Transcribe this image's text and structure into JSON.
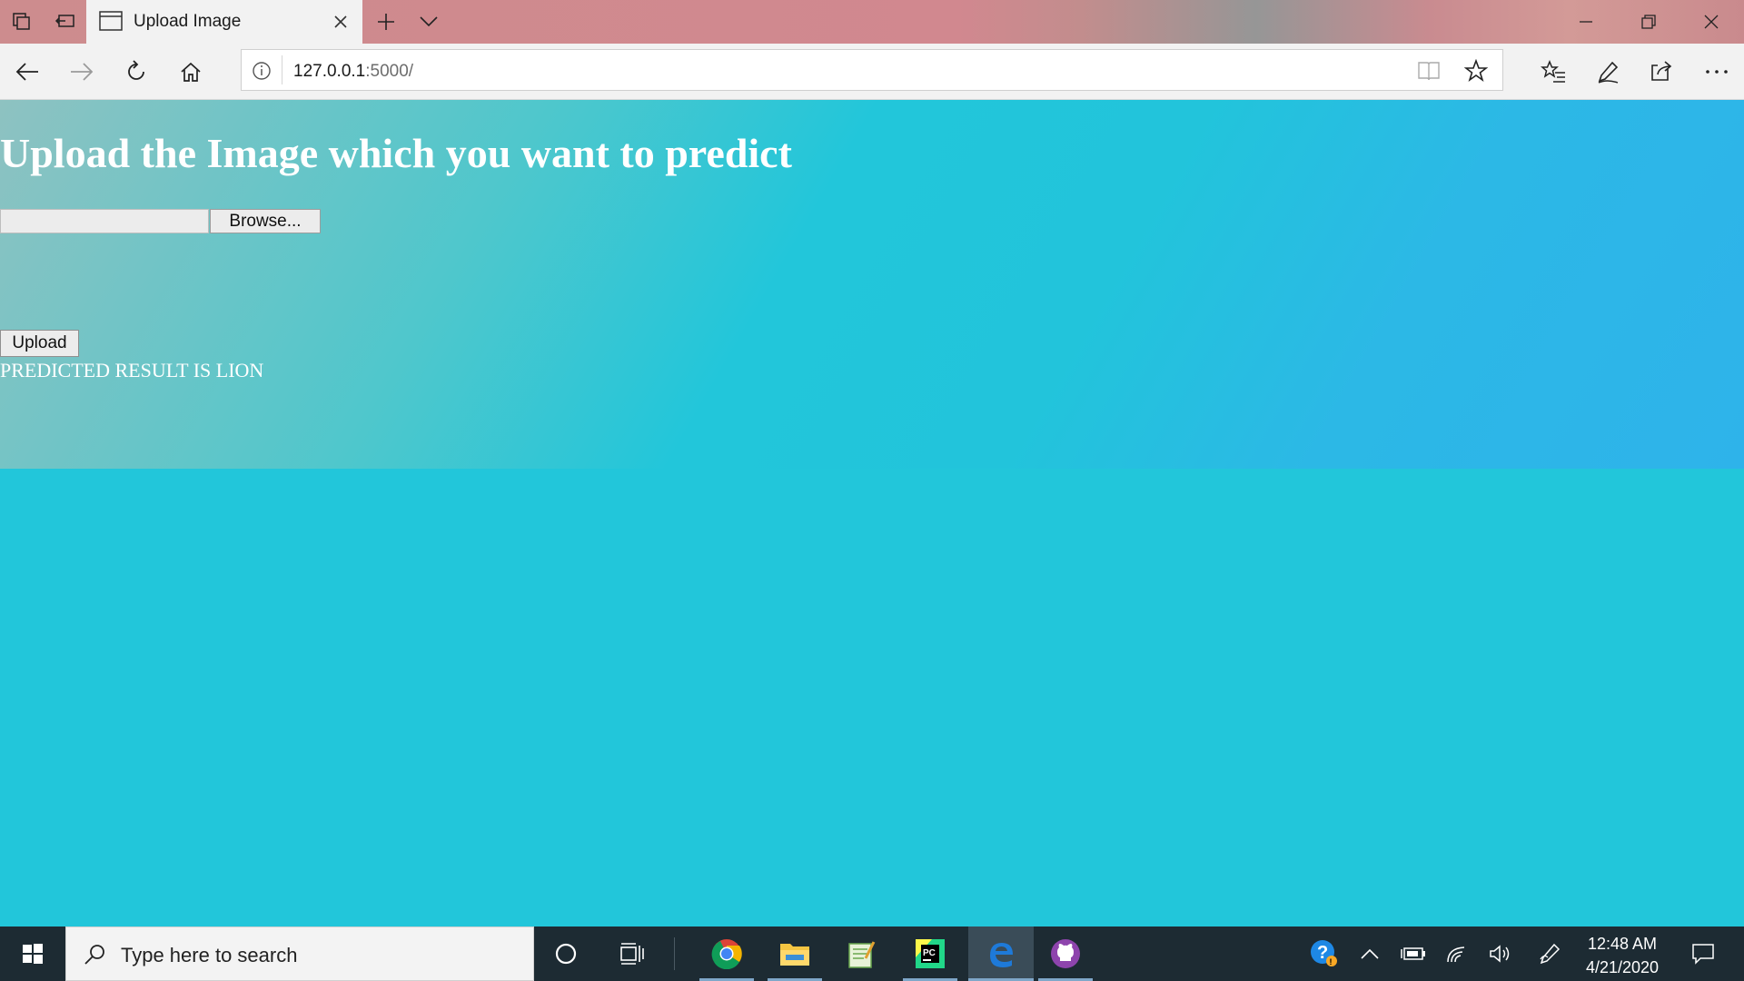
{
  "browser": {
    "tab_title": "Upload Image",
    "address_host": "127.0.0.1",
    "address_path": ":5000/"
  },
  "page": {
    "heading": "Upload the Image which you want to predict",
    "file_input_value": "",
    "browse_label": "Browse...",
    "upload_label": "Upload",
    "result_text": "PREDICTED RESULT IS LION"
  },
  "taskbar": {
    "search_placeholder": "Type here to search",
    "pinned_apps": [
      "cortana-icon",
      "task-view-icon",
      "chrome-icon",
      "file-explorer-icon",
      "notepad-icon",
      "pycharm-icon",
      "edge-icon",
      "github-desktop-icon"
    ],
    "active_app": "edge-icon",
    "tray_icons": [
      "help-icon",
      "chevron-up-icon",
      "battery-icon",
      "wifi-icon",
      "volume-icon",
      "pen-icon"
    ],
    "time": "12:48 AM",
    "date": "4/21/2020"
  },
  "colors": {
    "page_background": "#22c6da",
    "taskbar": "#1d2b33",
    "titlebar": "#cd8c8e"
  }
}
